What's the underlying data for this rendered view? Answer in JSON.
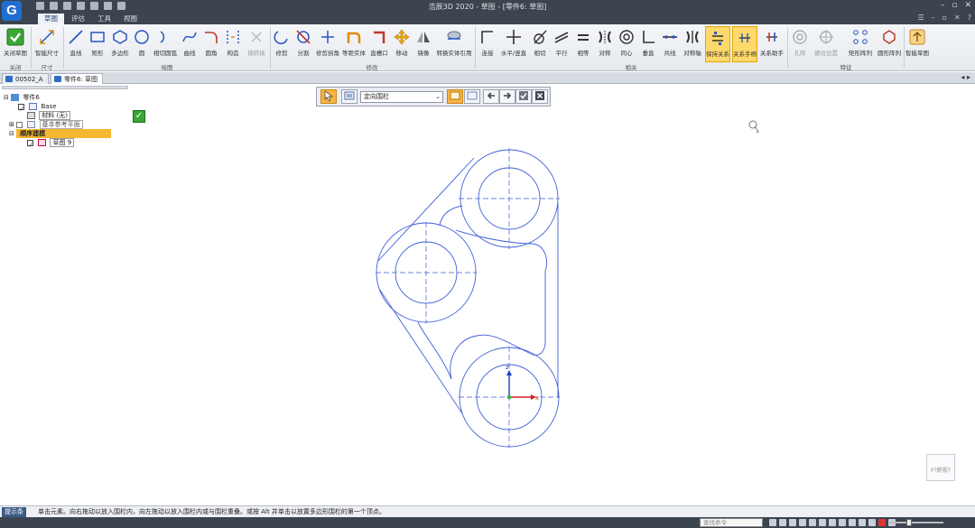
{
  "app": {
    "logo": "G",
    "title": "浩辰3D 2020 - 草图 - [零件6: 草图]",
    "window_controls": [
      "–",
      "▫",
      "✕"
    ],
    "tabs": [
      "草图",
      "评估",
      "工具",
      "视图"
    ],
    "tab_controls": [
      "☰",
      "–",
      "▫",
      "✕",
      "?"
    ]
  },
  "ribbon": {
    "buttons": [
      {
        "label": "关闭草图"
      },
      {
        "label": "智能尺寸"
      },
      {
        "label": "直线"
      },
      {
        "label": "矩形"
      },
      {
        "label": "多边形"
      },
      {
        "label": "圆"
      },
      {
        "label": "相切圆弧"
      },
      {
        "label": "曲线"
      },
      {
        "label": "圆角"
      },
      {
        "label": "构造"
      },
      {
        "label": "镜转换"
      },
      {
        "label": "修剪"
      },
      {
        "label": "分割"
      },
      {
        "label": "修剪拐角"
      },
      {
        "label": "等距实体"
      },
      {
        "label": "直槽口"
      },
      {
        "label": "移动"
      },
      {
        "label": "镜像"
      },
      {
        "label": "转换实体引用"
      },
      {
        "label": "连接"
      },
      {
        "label": "水平/竖直"
      },
      {
        "label": "相切"
      },
      {
        "label": "平行"
      },
      {
        "label": "相等"
      },
      {
        "label": "对称"
      },
      {
        "label": "同心"
      },
      {
        "label": "垂直"
      },
      {
        "label": "共线"
      },
      {
        "label": "对称轴"
      },
      {
        "label": "保持关系"
      },
      {
        "label": "关系手柄"
      },
      {
        "label": "关系助手"
      },
      {
        "label": "孔阵"
      },
      {
        "label": "螺纹设置"
      },
      {
        "label": "矩形阵列"
      },
      {
        "label": "圆形阵列"
      },
      {
        "label": "智能草图"
      }
    ],
    "groups": [
      "关闭",
      "尺寸",
      "绘图",
      "修改",
      "相关",
      "特征"
    ]
  },
  "doc_tabs": {
    "items": [
      "00502_A",
      "零件6: 草图"
    ],
    "controls": "◂ ▸"
  },
  "tree": {
    "root": "零件6",
    "base": "Base",
    "material": "材料 (无)",
    "ref_planes": "基本参考平面",
    "rollback": "顺序建模",
    "sketch": "草图 9"
  },
  "selection_bar": {
    "dropdown_value": "定向围栏"
  },
  "triad_label": "F?俯视?",
  "status": {
    "prompt_label": "提示条",
    "prompt_text": "单击元素。向右拖动以放入围栏内，向左拖动以放入围栏内或与围栏重叠。或按 Alt 并单击以放置多边形围栏的第一个顶点。",
    "command_search_placeholder": "查找命令"
  },
  "colors": {
    "sketch": "#3f5fd8",
    "accent": "#f7b343",
    "chrome": "#3c4450"
  }
}
